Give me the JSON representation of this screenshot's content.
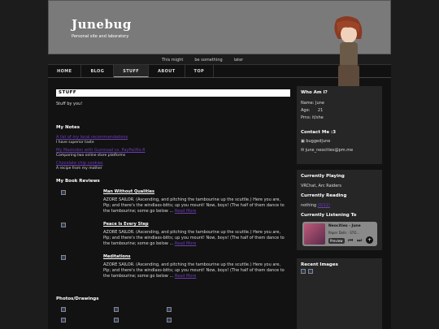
{
  "header": {
    "title": "Junebug",
    "subtitle": "Personal site and laboratory"
  },
  "marquee": [
    "This might",
    "be something",
    "later"
  ],
  "nav": [
    "HOME",
    "BLOG",
    "STUFF",
    "ABOUT",
    "TOP"
  ],
  "page": {
    "heading": "STUFF",
    "intro": "Stuff by you!"
  },
  "notes": {
    "heading": "My Notes",
    "items": [
      {
        "link": "A list of my local recommendations",
        "desc": "I have superior taste"
      },
      {
        "link": "My Mastodon with Gumroad vs. PayPal/Ko-fi",
        "desc": "Comparing two online store platforms"
      },
      {
        "link": "Chocolate chip cookies",
        "desc": "A recipe from my mother"
      }
    ]
  },
  "reviews": {
    "heading": "My Book Reviews",
    "items": [
      {
        "title": "Man Without Qualities",
        "text": "AZORE SAILOR. (Ascending, and pitching the tambourine up the scuttle.) Here you are, Pip; and there's the windlass-bitts; up you mount! Now, boys! (The half of them dance to the tambourine; some go below ...",
        "more": "Read More"
      },
      {
        "title": "Peace Is Every Step",
        "text": "AZORE SAILOR. (Ascending, and pitching the tambourine up the scuttle.) Here you are, Pip; and there's the windlass-bitts; up you mount! Now, boys! (The half of them dance to the tambourine; some go below ...",
        "more": "Read More"
      },
      {
        "title": "Meditations",
        "text": "AZORE SAILOR. (Ascending, and pitching the tambourine up the scuttle.) Here you are, Pip; and there's the windlass-bitts; up you mount! Now, boys! (The half of them dance to the tambourine; some go below ...",
        "more": "Read More"
      }
    ]
  },
  "photos": {
    "heading": "Photos/Drawings"
  },
  "about": {
    "heading": "Who Am I?",
    "name_label": "Name:",
    "name": "June",
    "age_label": "Age:",
    "age": "21",
    "prns_label": "Prns:",
    "prns": "it/she"
  },
  "contact": {
    "heading": "Contact Me :3",
    "handle": "bugged|une",
    "email": "june_neocities@pm.me"
  },
  "playing": {
    "heading": "Currently Playing",
    "value": "VRChat, Arc Raiders"
  },
  "reading": {
    "heading": "Currently Reading",
    "value": "nothing",
    "value2": "(0/11)"
  },
  "listening": {
    "heading": "Currently Listening To",
    "track": "Neocities - June",
    "artist": "Paper Dolls · STO...",
    "preview": "Preview"
  },
  "recent_images": {
    "heading": "Recent Images"
  },
  "colors": {
    "accent": "#6a3fb3",
    "header_bg": "#7a7a7a",
    "panel": "#262626"
  }
}
